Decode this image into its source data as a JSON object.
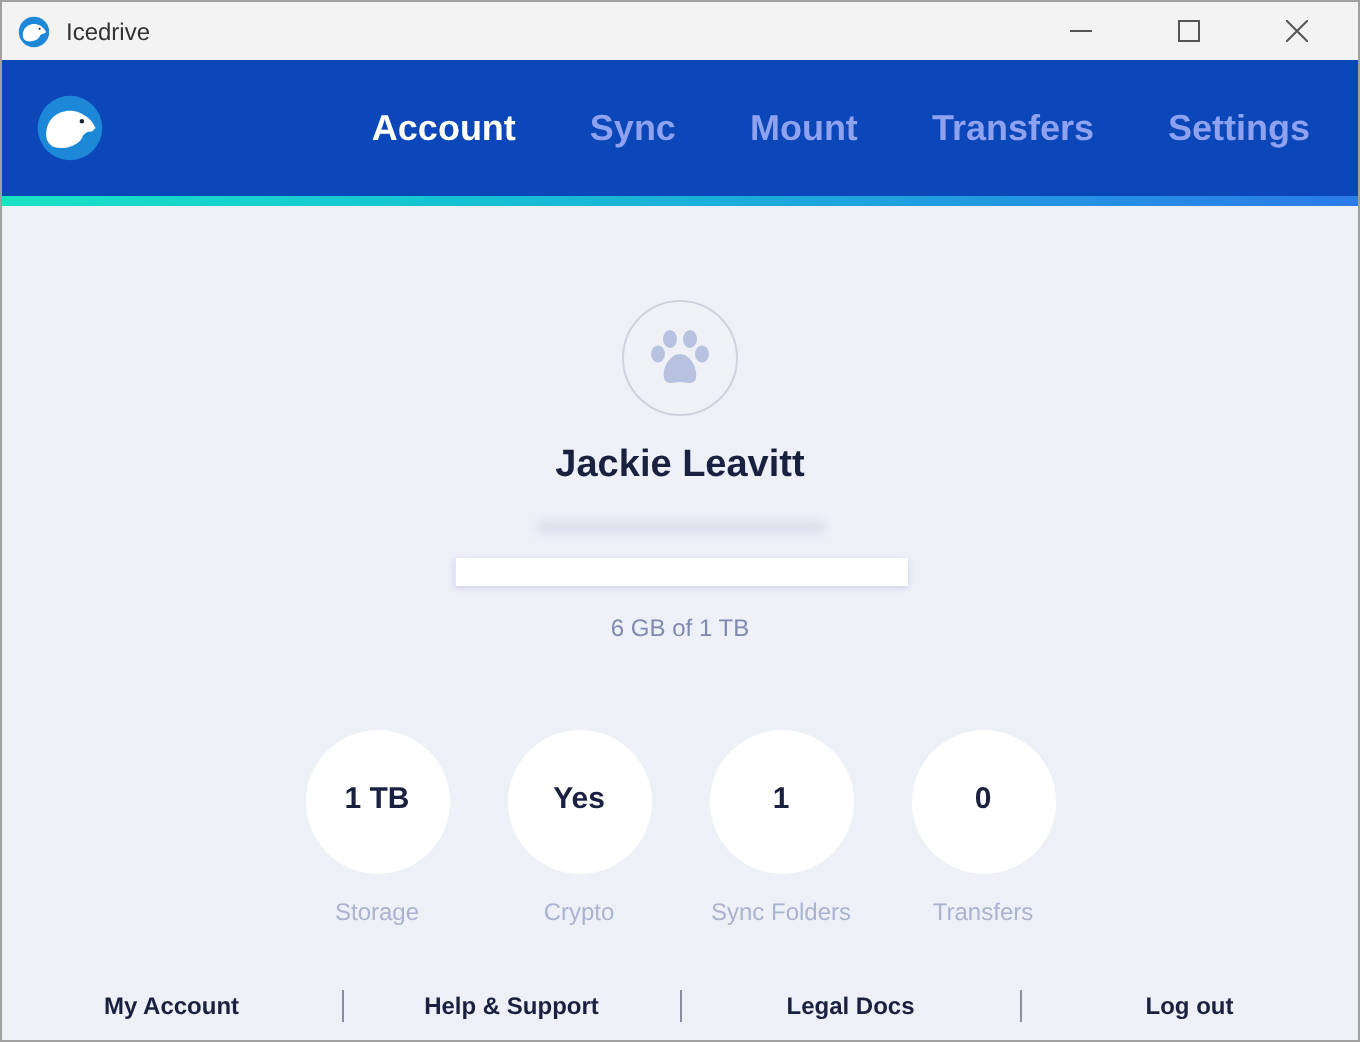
{
  "window": {
    "title": "Icedrive"
  },
  "tabs": [
    {
      "label": "Account",
      "selected": true
    },
    {
      "label": "Sync",
      "selected": false
    },
    {
      "label": "Mount",
      "selected": false
    },
    {
      "label": "Transfers",
      "selected": false
    },
    {
      "label": "Settings",
      "selected": false
    }
  ],
  "profile": {
    "name": "Jackie Leavitt",
    "storage": {
      "level": 0.006,
      "reading": "6 GB of 1 TB"
    }
  },
  "stats": [
    {
      "value": "1 TB",
      "label": "Storage"
    },
    {
      "value": "Yes",
      "label": "Crypto"
    },
    {
      "value": "1",
      "label": "Sync Folders"
    },
    {
      "value": "0",
      "label": "Transfers"
    }
  ],
  "footer_links": [
    "My Account",
    "Help & Support",
    "Legal Docs",
    "Log out"
  ]
}
